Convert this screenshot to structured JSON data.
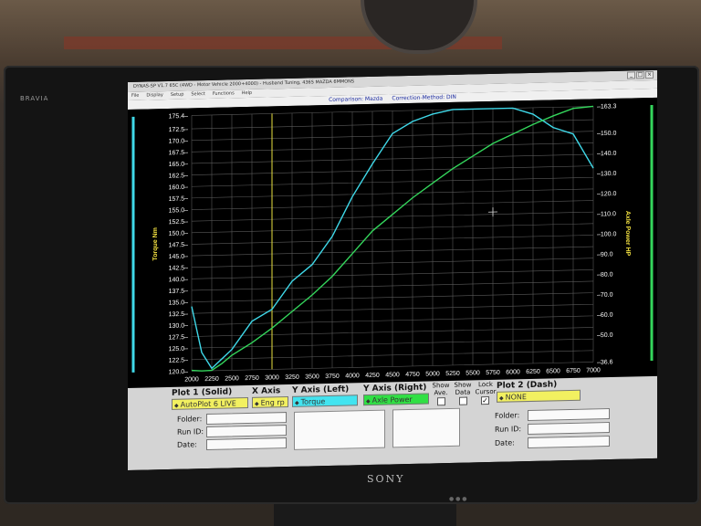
{
  "monitor": {
    "brand_left": "BRAVIA",
    "brand_center": "SONY"
  },
  "window": {
    "title": "DYNAS-SP V1.7 65C  (4WD - Motor Vehicle 2000+4000) - Husband Tuning, 4365 MAZDA 6MMONS",
    "menu": [
      "File",
      "Display",
      "Setup",
      "Select",
      "Functions",
      "Help"
    ],
    "buttons": {
      "minimize": "_",
      "maximize": "□",
      "close": "×"
    }
  },
  "info": {
    "comparison": "Comparison: Mazda",
    "correction": "Correction-Method: DIN"
  },
  "chart_data": {
    "type": "line",
    "background": "#000000",
    "grid": true,
    "x": [
      2000,
      2125,
      2250,
      2375,
      2500,
      2750,
      3000,
      3250,
      3500,
      3750,
      4000,
      4250,
      4500,
      4750,
      5000,
      5250,
      5500,
      5750,
      6000,
      6250,
      6500,
      6750,
      7000
    ],
    "xlim": [
      2000,
      7000
    ],
    "x_ticks": [
      "2000",
      "2250",
      "2500",
      "2750",
      "3000",
      "3250",
      "3500",
      "3750",
      "4000",
      "4250",
      "4500",
      "4750",
      "5000",
      "5250",
      "5500",
      "5750",
      "6000",
      "6250",
      "6500",
      "6750",
      "7000"
    ],
    "ylabel_left": "Torque Nm",
    "ylim_left": [
      120.0,
      175.4
    ],
    "y_ticks_left": [
      "120.0",
      "122.5",
      "125.0",
      "127.5",
      "130.0",
      "132.5",
      "135.0",
      "137.5",
      "140.0",
      "142.5",
      "145.0",
      "147.5",
      "150.0",
      "152.5",
      "155.0",
      "157.5",
      "160.0",
      "162.5",
      "165.0",
      "167.5",
      "170.0",
      "172.5",
      "175.4"
    ],
    "ylabel_right": "Axle Power HP",
    "ylim_right": [
      36.6,
      163.3
    ],
    "y_ticks_right": [
      "36.6",
      "50.0",
      "60.0",
      "70.0",
      "80.0",
      "90.0",
      "100.0",
      "110.0",
      "120.0",
      "130.0",
      "140.0",
      "150.0",
      "163.3"
    ],
    "cursor_x": 3000,
    "series": [
      {
        "name": "Torque",
        "axis": "left",
        "color": "#3fd8e8",
        "values": [
          134.0,
          124.0,
          120.5,
          122.5,
          124.5,
          130.5,
          133.0,
          139.0,
          142.5,
          148.5,
          157.0,
          164.0,
          170.5,
          173.0,
          174.5,
          175.4,
          175.4,
          175.4,
          175.4,
          174.0,
          171.0,
          169.5,
          162.0
        ]
      },
      {
        "name": "Axle Power",
        "axis": "right",
        "color": "#34d65c",
        "values": [
          37.0,
          36.6,
          36.8,
          40.0,
          44.0,
          50.0,
          57.0,
          65.0,
          73.0,
          82.0,
          93.0,
          104.0,
          112.0,
          120.0,
          127.0,
          134.0,
          140.0,
          146.0,
          150.5,
          155.0,
          159.0,
          162.5,
          163.3
        ]
      }
    ]
  },
  "panel": {
    "plot1": {
      "label": "Plot 1 (Solid)",
      "value": "AutoPlot 6 LIVE"
    },
    "xaxis": {
      "label": "X Axis",
      "value": "Eng rp"
    },
    "yleft": {
      "label": "Y Axis (Left)",
      "value": "Torque"
    },
    "yright": {
      "label": "Y Axis (Right)",
      "value": "Axle Power"
    },
    "show_ave": "Show Ave.",
    "show_data": "Show Data",
    "lock_cursor": "Lock Cursor",
    "lock_cursor_checked": "✓",
    "plot2": {
      "label": "Plot 2 (Dash)",
      "value": "NONE"
    },
    "folder_label": "Folder:",
    "runid_label": "Run ID:",
    "date_label": "Date:"
  }
}
